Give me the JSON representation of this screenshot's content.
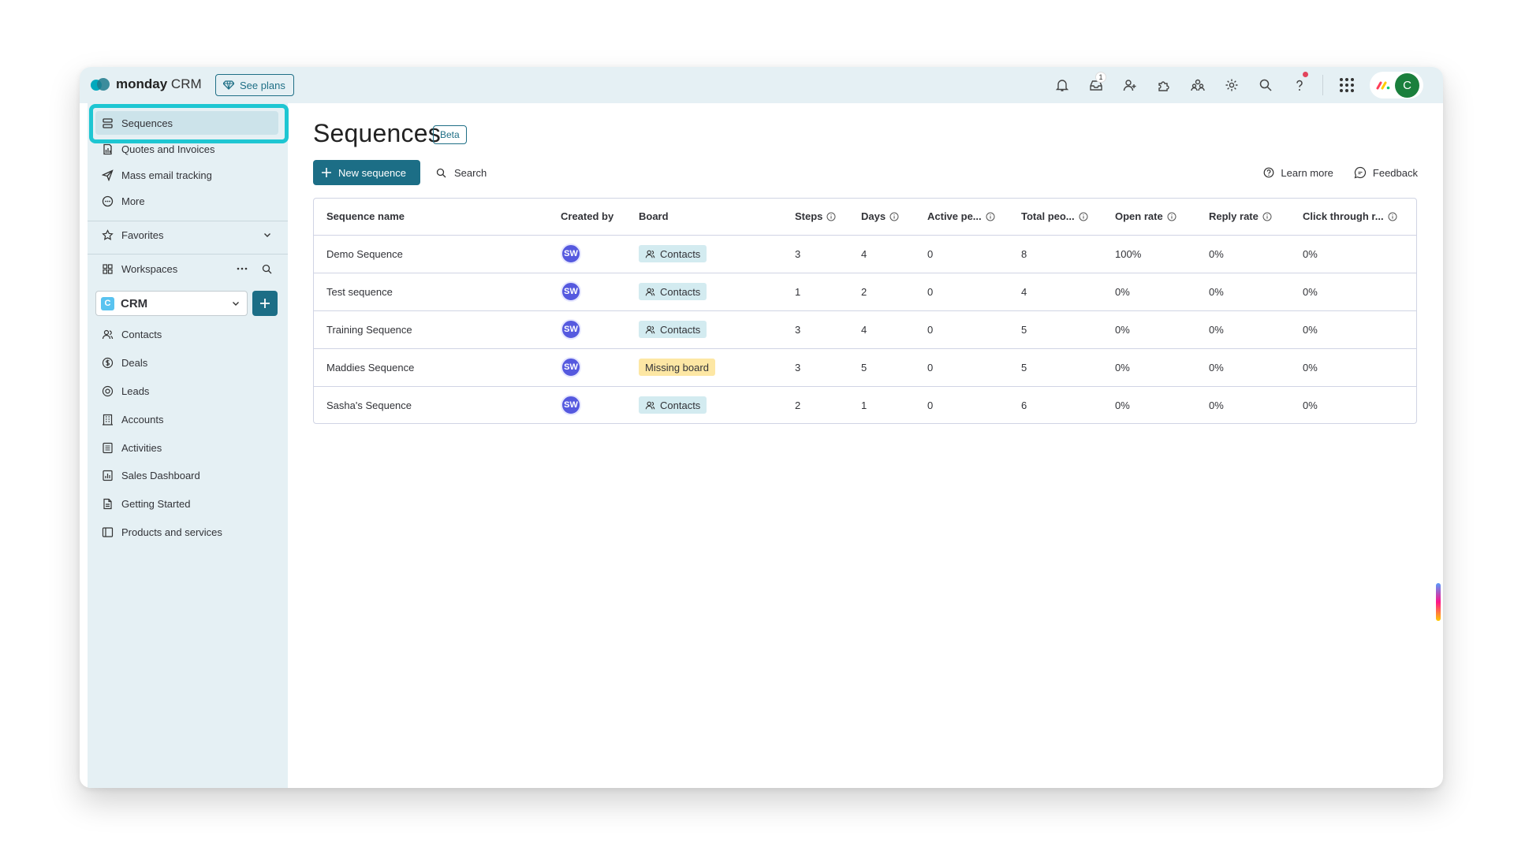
{
  "app": {
    "brand_bold": "monday",
    "brand_light": "CRM",
    "see_plans_label": "See plans",
    "inbox_count": "1",
    "user_initial": "C"
  },
  "sidebar": {
    "top_items": [
      {
        "label": "Sequences",
        "icon": "sequences-icon"
      },
      {
        "label": "Quotes and Invoices",
        "icon": "invoice-icon"
      },
      {
        "label": "Mass email tracking",
        "icon": "send-icon"
      },
      {
        "label": "More",
        "icon": "more-circle-icon"
      }
    ],
    "favorites_label": "Favorites",
    "workspaces_label": "Workspaces",
    "workspace": {
      "letter": "C",
      "name": "CRM"
    },
    "boards": [
      {
        "label": "Contacts",
        "icon": "contacts-icon"
      },
      {
        "label": "Deals",
        "icon": "dollar-icon"
      },
      {
        "label": "Leads",
        "icon": "target-icon"
      },
      {
        "label": "Accounts",
        "icon": "building-icon"
      },
      {
        "label": "Activities",
        "icon": "activities-icon"
      },
      {
        "label": "Sales Dashboard",
        "icon": "dashboard-icon"
      },
      {
        "label": "Getting Started",
        "icon": "doc-icon"
      },
      {
        "label": "Products and services",
        "icon": "products-icon"
      }
    ]
  },
  "main": {
    "title": "Sequences",
    "beta_label": "Beta",
    "new_sequence_label": "New sequence",
    "search_label": "Search",
    "learn_more_label": "Learn more",
    "feedback_label": "Feedback"
  },
  "table": {
    "headers": [
      "Sequence name",
      "Created by",
      "Board",
      "Steps",
      "Days",
      "Active pe...",
      "Total peo...",
      "Open rate",
      "Reply rate",
      "Click through r..."
    ],
    "rows": [
      {
        "name": "Demo Sequence",
        "creator": "SW",
        "board": "Contacts",
        "missing": false,
        "steps": "3",
        "days": "4",
        "active": "0",
        "total": "8",
        "open": "100%",
        "reply": "0%",
        "click": "0%"
      },
      {
        "name": "Test sequence",
        "creator": "SW",
        "board": "Contacts",
        "missing": false,
        "steps": "1",
        "days": "2",
        "active": "0",
        "total": "4",
        "open": "0%",
        "reply": "0%",
        "click": "0%"
      },
      {
        "name": "Training Sequence",
        "creator": "SW",
        "board": "Contacts",
        "missing": false,
        "steps": "3",
        "days": "4",
        "active": "0",
        "total": "5",
        "open": "0%",
        "reply": "0%",
        "click": "0%"
      },
      {
        "name": "Maddies Sequence",
        "creator": "SW",
        "board": "Missing board",
        "missing": true,
        "steps": "3",
        "days": "5",
        "active": "0",
        "total": "5",
        "open": "0%",
        "reply": "0%",
        "click": "0%"
      },
      {
        "name": "Sasha's Sequence",
        "creator": "SW",
        "board": "Contacts",
        "missing": false,
        "steps": "2",
        "days": "1",
        "active": "0",
        "total": "6",
        "open": "0%",
        "reply": "0%",
        "click": "0%"
      }
    ]
  },
  "colors": {
    "accent": "#1c6e86",
    "highlight": "#1ec6d2",
    "avatar": "#5559df",
    "chip": "#d3ebf0",
    "missing_chip": "#fde7a4"
  }
}
